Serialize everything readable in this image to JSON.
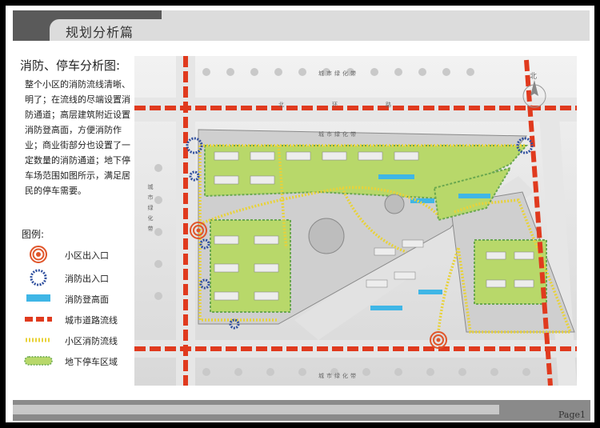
{
  "header": {
    "section_title": "规划分析篇"
  },
  "main": {
    "title": "消防、停车分析图:",
    "description": "整个小区的消防流线清晰、明了；在流线的尽端设置消防通道；高层建筑附近设置消防登高面，方便消防作业；商业街部分也设置了一定数量的消防通道；地下停车场范围如图所示，满足居民的停车需要。",
    "legend_title": "图例:",
    "legend": [
      {
        "icon": "community-entrance-icon",
        "label": "小区出入口"
      },
      {
        "icon": "fire-exit-icon",
        "label": "消防出入口"
      },
      {
        "icon": "fire-climbing-surface-icon",
        "label": "消防登高面"
      },
      {
        "icon": "city-road-flow-icon",
        "label": "城市道路流线"
      },
      {
        "icon": "community-fire-route-icon",
        "label": "小区消防流线"
      },
      {
        "icon": "underground-parking-icon",
        "label": "地下停车区域"
      }
    ]
  },
  "map": {
    "labels": {
      "top_green": "城市绿化带",
      "top_road": "北环路",
      "inner_green": "城市绿化带",
      "left_green": "城市绿化带",
      "bottom_green": "城市绿化带",
      "north": "北"
    }
  },
  "footer": {
    "page": "Page1"
  },
  "colors": {
    "road_flow": "#e03a1e",
    "fire_route": "#e8d23a",
    "parking": "#b8d86a",
    "fire_surface": "#3fb6e6",
    "fire_exit": "#2f4f9e",
    "entrance": "#e0552a"
  }
}
